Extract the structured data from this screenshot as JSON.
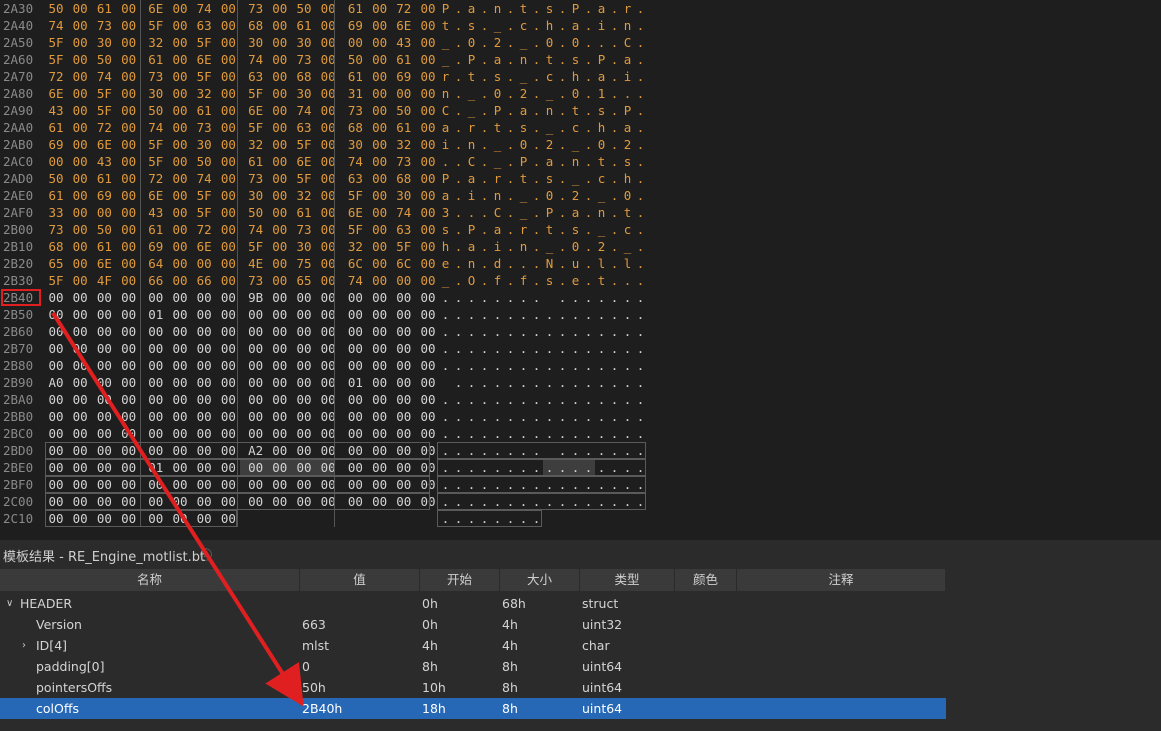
{
  "hex": {
    "rows": [
      {
        "addr": "2A30",
        "bytes": [
          "50",
          "00",
          "61",
          "00",
          "6E",
          "00",
          "74",
          "00",
          "73",
          "00",
          "50",
          "00",
          "61",
          "00",
          "72",
          "00"
        ],
        "ascii": "P.a.n.t.s.P.a.r.",
        "color": "orange"
      },
      {
        "addr": "2A40",
        "bytes": [
          "74",
          "00",
          "73",
          "00",
          "5F",
          "00",
          "63",
          "00",
          "68",
          "00",
          "61",
          "00",
          "69",
          "00",
          "6E",
          "00"
        ],
        "ascii": "t.s._.c.h.a.i.n.",
        "color": "orange"
      },
      {
        "addr": "2A50",
        "bytes": [
          "5F",
          "00",
          "30",
          "00",
          "32",
          "00",
          "5F",
          "00",
          "30",
          "00",
          "30",
          "00",
          "00",
          "00",
          "43",
          "00"
        ],
        "ascii": "_.0.2._.0.0...C.",
        "color": "orange"
      },
      {
        "addr": "2A60",
        "bytes": [
          "5F",
          "00",
          "50",
          "00",
          "61",
          "00",
          "6E",
          "00",
          "74",
          "00",
          "73",
          "00",
          "50",
          "00",
          "61",
          "00"
        ],
        "ascii": "_.P.a.n.t.s.P.a.",
        "color": "orange"
      },
      {
        "addr": "2A70",
        "bytes": [
          "72",
          "00",
          "74",
          "00",
          "73",
          "00",
          "5F",
          "00",
          "63",
          "00",
          "68",
          "00",
          "61",
          "00",
          "69",
          "00"
        ],
        "ascii": "r.t.s._.c.h.a.i.",
        "color": "orange"
      },
      {
        "addr": "2A80",
        "bytes": [
          "6E",
          "00",
          "5F",
          "00",
          "30",
          "00",
          "32",
          "00",
          "5F",
          "00",
          "30",
          "00",
          "31",
          "00",
          "00",
          "00"
        ],
        "ascii": "n._.0.2._.0.1...",
        "color": "orange"
      },
      {
        "addr": "2A90",
        "bytes": [
          "43",
          "00",
          "5F",
          "00",
          "50",
          "00",
          "61",
          "00",
          "6E",
          "00",
          "74",
          "00",
          "73",
          "00",
          "50",
          "00"
        ],
        "ascii": "C._.P.a.n.t.s.P.",
        "color": "orange"
      },
      {
        "addr": "2AA0",
        "bytes": [
          "61",
          "00",
          "72",
          "00",
          "74",
          "00",
          "73",
          "00",
          "5F",
          "00",
          "63",
          "00",
          "68",
          "00",
          "61",
          "00"
        ],
        "ascii": "a.r.t.s._.c.h.a.",
        "color": "orange"
      },
      {
        "addr": "2AB0",
        "bytes": [
          "69",
          "00",
          "6E",
          "00",
          "5F",
          "00",
          "30",
          "00",
          "32",
          "00",
          "5F",
          "00",
          "30",
          "00",
          "32",
          "00"
        ],
        "ascii": "i.n._.0.2._.0.2.",
        "color": "orange"
      },
      {
        "addr": "2AC0",
        "bytes": [
          "00",
          "00",
          "43",
          "00",
          "5F",
          "00",
          "50",
          "00",
          "61",
          "00",
          "6E",
          "00",
          "74",
          "00",
          "73",
          "00"
        ],
        "ascii": "..C._.P.a.n.t.s.",
        "color": "orange"
      },
      {
        "addr": "2AD0",
        "bytes": [
          "50",
          "00",
          "61",
          "00",
          "72",
          "00",
          "74",
          "00",
          "73",
          "00",
          "5F",
          "00",
          "63",
          "00",
          "68",
          "00"
        ],
        "ascii": "P.a.r.t.s._.c.h.",
        "color": "orange"
      },
      {
        "addr": "2AE0",
        "bytes": [
          "61",
          "00",
          "69",
          "00",
          "6E",
          "00",
          "5F",
          "00",
          "30",
          "00",
          "32",
          "00",
          "5F",
          "00",
          "30",
          "00"
        ],
        "ascii": "a.i.n._.0.2._.0.",
        "color": "orange"
      },
      {
        "addr": "2AF0",
        "bytes": [
          "33",
          "00",
          "00",
          "00",
          "43",
          "00",
          "5F",
          "00",
          "50",
          "00",
          "61",
          "00",
          "6E",
          "00",
          "74",
          "00"
        ],
        "ascii": "3...C._.P.a.n.t.",
        "color": "orange"
      },
      {
        "addr": "2B00",
        "bytes": [
          "73",
          "00",
          "50",
          "00",
          "61",
          "00",
          "72",
          "00",
          "74",
          "00",
          "73",
          "00",
          "5F",
          "00",
          "63",
          "00"
        ],
        "ascii": "s.P.a.r.t.s._.c.",
        "color": "orange"
      },
      {
        "addr": "2B10",
        "bytes": [
          "68",
          "00",
          "61",
          "00",
          "69",
          "00",
          "6E",
          "00",
          "5F",
          "00",
          "30",
          "00",
          "32",
          "00",
          "5F",
          "00"
        ],
        "ascii": "h.a.i.n._.0.2._.",
        "color": "orange"
      },
      {
        "addr": "2B20",
        "bytes": [
          "65",
          "00",
          "6E",
          "00",
          "64",
          "00",
          "00",
          "00",
          "4E",
          "00",
          "75",
          "00",
          "6C",
          "00",
          "6C",
          "00"
        ],
        "ascii": "e.n.d...N.u.l.l.",
        "color": "orange"
      },
      {
        "addr": "2B30",
        "bytes": [
          "5F",
          "00",
          "4F",
          "00",
          "66",
          "00",
          "66",
          "00",
          "73",
          "00",
          "65",
          "00",
          "74",
          "00",
          "00",
          "00"
        ],
        "ascii": "_.O.f.f.s.e.t...",
        "color": "orange"
      },
      {
        "addr": "2B40",
        "bytes": [
          "00",
          "00",
          "00",
          "00",
          "00",
          "00",
          "00",
          "00",
          "9B",
          "00",
          "00",
          "00",
          "00",
          "00",
          "00",
          "00"
        ],
        "ascii": "........ .......",
        "color": "white"
      },
      {
        "addr": "2B50",
        "bytes": [
          "00",
          "00",
          "00",
          "00",
          "01",
          "00",
          "00",
          "00",
          "00",
          "00",
          "00",
          "00",
          "00",
          "00",
          "00",
          "00"
        ],
        "ascii": "................",
        "color": "white"
      },
      {
        "addr": "2B60",
        "bytes": [
          "00",
          "00",
          "00",
          "00",
          "00",
          "00",
          "00",
          "00",
          "00",
          "00",
          "00",
          "00",
          "00",
          "00",
          "00",
          "00"
        ],
        "ascii": "................",
        "color": "white"
      },
      {
        "addr": "2B70",
        "bytes": [
          "00",
          "00",
          "00",
          "00",
          "00",
          "00",
          "00",
          "00",
          "00",
          "00",
          "00",
          "00",
          "00",
          "00",
          "00",
          "00"
        ],
        "ascii": "................",
        "color": "white"
      },
      {
        "addr": "2B80",
        "bytes": [
          "00",
          "00",
          "00",
          "00",
          "00",
          "00",
          "00",
          "00",
          "00",
          "00",
          "00",
          "00",
          "00",
          "00",
          "00",
          "00"
        ],
        "ascii": "................",
        "color": "white"
      },
      {
        "addr": "2B90",
        "bytes": [
          "A0",
          "00",
          "00",
          "00",
          "00",
          "00",
          "00",
          "00",
          "00",
          "00",
          "00",
          "00",
          "01",
          "00",
          "00",
          "00"
        ],
        "ascii": " ...............",
        "color": "white"
      },
      {
        "addr": "2BA0",
        "bytes": [
          "00",
          "00",
          "00",
          "00",
          "00",
          "00",
          "00",
          "00",
          "00",
          "00",
          "00",
          "00",
          "00",
          "00",
          "00",
          "00"
        ],
        "ascii": "................",
        "color": "white"
      },
      {
        "addr": "2BB0",
        "bytes": [
          "00",
          "00",
          "00",
          "00",
          "00",
          "00",
          "00",
          "00",
          "00",
          "00",
          "00",
          "00",
          "00",
          "00",
          "00",
          "00"
        ],
        "ascii": "................",
        "color": "white"
      },
      {
        "addr": "2BC0",
        "bytes": [
          "00",
          "00",
          "00",
          "00",
          "00",
          "00",
          "00",
          "00",
          "00",
          "00",
          "00",
          "00",
          "00",
          "00",
          "00",
          "00"
        ],
        "ascii": "................",
        "color": "white"
      },
      {
        "addr": "2BD0",
        "bytes": [
          "00",
          "00",
          "00",
          "00",
          "00",
          "00",
          "00",
          "00",
          "A2",
          "00",
          "00",
          "00",
          "00",
          "00",
          "00",
          "00"
        ],
        "ascii": "........ .......",
        "color": "white"
      },
      {
        "addr": "2BE0",
        "bytes": [
          "00",
          "00",
          "00",
          "00",
          "01",
          "00",
          "00",
          "00",
          "00",
          "00",
          "00",
          "00",
          "00",
          "00",
          "00",
          "00"
        ],
        "ascii": "................",
        "color": "white"
      },
      {
        "addr": "2BF0",
        "bytes": [
          "00",
          "00",
          "00",
          "00",
          "00",
          "00",
          "00",
          "00",
          "00",
          "00",
          "00",
          "00",
          "00",
          "00",
          "00",
          "00"
        ],
        "ascii": "................",
        "color": "white"
      },
      {
        "addr": "2C00",
        "bytes": [
          "00",
          "00",
          "00",
          "00",
          "00",
          "00",
          "00",
          "00",
          "00",
          "00",
          "00",
          "00",
          "00",
          "00",
          "00",
          "00"
        ],
        "ascii": "................",
        "color": "white"
      },
      {
        "addr": "2C10",
        "bytes": [
          "00",
          "00",
          "00",
          "00",
          "00",
          "00",
          "00",
          "00"
        ],
        "ascii": "........",
        "color": "white"
      }
    ]
  },
  "template": {
    "title": "模板结果 - RE_Engine_motlist.bt",
    "close_glyph": "ⓧ",
    "columns": [
      "名称",
      "值",
      "开始",
      "大小",
      "类型",
      "颜色",
      "注释"
    ],
    "rows": [
      {
        "name": "HEADER",
        "value": "",
        "start": "0h",
        "size": "68h",
        "type": "struct",
        "expander": "∨",
        "indent": 0
      },
      {
        "name": "Version",
        "value": "663",
        "start": "0h",
        "size": "4h",
        "type": "uint32",
        "expander": "",
        "indent": 1
      },
      {
        "name": "ID[4]",
        "value": "mlst",
        "start": "4h",
        "size": "4h",
        "type": "char",
        "expander": "›",
        "indent": 1
      },
      {
        "name": "padding[0]",
        "value": "0",
        "start": "8h",
        "size": "8h",
        "type": "uint64",
        "expander": "",
        "indent": 1
      },
      {
        "name": "pointersOffs",
        "value": "50h",
        "start": "10h",
        "size": "8h",
        "type": "uint64",
        "expander": "",
        "indent": 1
      },
      {
        "name": "colOffs",
        "value": "2B40h",
        "start": "18h",
        "size": "8h",
        "type": "uint64",
        "expander": "",
        "indent": 1,
        "selected": true
      }
    ]
  },
  "colors": {
    "accent_selection": "#2668b5",
    "annotation_red": "#e02020",
    "hex_text": "#e09a3e"
  }
}
